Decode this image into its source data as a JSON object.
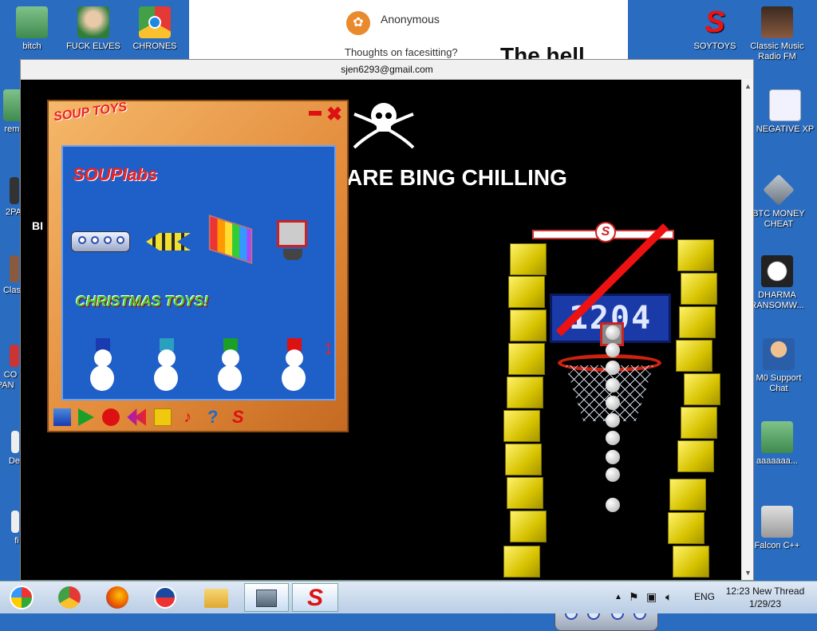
{
  "desktop_icons": {
    "bitch": "bitch",
    "fuck_elves": "FUCK ELVES",
    "chrones": "CHRONES",
    "soytoys": "SOYTOYS",
    "classic_music": "Classic Music Radio FM",
    "negative_xp": "NEGATIVE XP",
    "btc_money_cheat": "BTC MONEY CHEAT",
    "dharma": "DHARMA RANSOMW...",
    "support_chat": "M0 Support Chat",
    "aaaa": "aaaaaaa...",
    "falcon": "Falcon C++",
    "left_rem": "rem",
    "left_2pa": "2PA",
    "left_clas": "Clas",
    "left_co": "CO SPAN",
    "left_de": "De",
    "left_fi": "fi"
  },
  "notification": {
    "author": "Anonymous",
    "message": "Thoughts on facesitting?",
    "big_text": "The hell"
  },
  "browser": {
    "title": "sjen6293@gmail.com",
    "headline": "ARE BING CHILLING",
    "side_text": "BI"
  },
  "basketball": {
    "score": "1204",
    "logo": "S"
  },
  "soup_toys": {
    "brand": "SOUP TOYS",
    "lab_title": "SOUPlabs",
    "christmas_title": "CHRISTMAS TOYS!"
  },
  "taskbar": {
    "language": "ENG",
    "time": "12:23 New Thread",
    "date": "1/29/23"
  },
  "colors": {
    "desktop": "#2a6cc0",
    "soup_panel": "#e28a3a",
    "score_board": "#1a3aa8",
    "block_yellow": "#fff26a"
  }
}
